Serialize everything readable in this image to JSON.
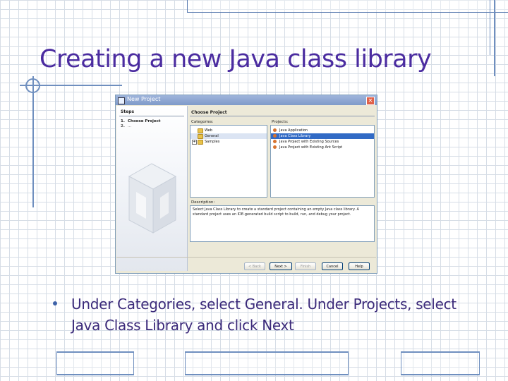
{
  "slide": {
    "title": "Creating a new Java class library",
    "bullet": "Under Categories, select General. Under Projects, select Java Class Library and click Next"
  },
  "window": {
    "title": "New Project",
    "steps_heading": "Steps",
    "steps": [
      {
        "num": "1.",
        "label": "Choose Project"
      },
      {
        "num": "2.",
        "label": "..."
      }
    ],
    "main_heading": "Choose Project",
    "categories_label": "Categories:",
    "projects_label": "Projects:",
    "categories": [
      {
        "label": "Web",
        "selected": false,
        "expandable": false
      },
      {
        "label": "General",
        "selected": true,
        "expandable": false
      },
      {
        "label": "Samples",
        "selected": false,
        "expandable": true
      }
    ],
    "projects": [
      {
        "label": "Java Application",
        "selected": false
      },
      {
        "label": "Java Class Library",
        "selected": true
      },
      {
        "label": "Java Project with Existing Sources",
        "selected": false
      },
      {
        "label": "Java Project with Existing Ant Script",
        "selected": false
      }
    ],
    "description_label": "Description:",
    "description": "Select Java Class Library to create a standard project containing an empty Java class library. A standard project uses an IDE-generated build script to build, run, and debug your project.",
    "buttons": {
      "back": "< Back",
      "next": "Next >",
      "finish": "Finish",
      "cancel": "Cancel",
      "help": "Help"
    }
  },
  "colors": {
    "title": "#4b2ca0",
    "bullet_text": "#3b2a7a",
    "accent": "#6f8fbf",
    "selection": "#316ac5"
  }
}
